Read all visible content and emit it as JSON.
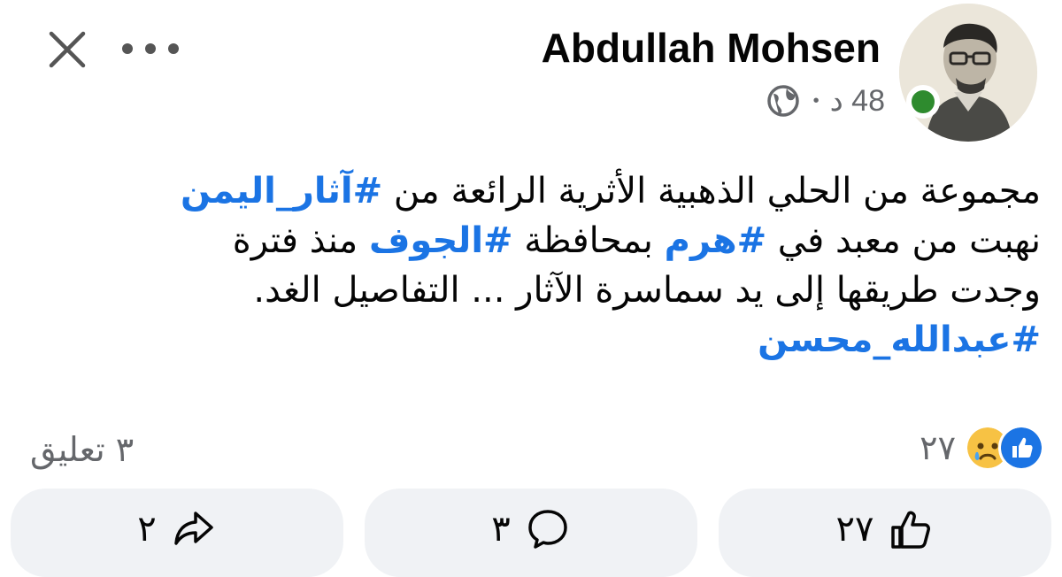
{
  "post": {
    "author_name": "Abdullah Mohsen",
    "time_ago": "48 د",
    "meta_separator": "•",
    "body_lines": [
      {
        "pre": "مجموعة من الحلي الذهبية الأثرية الرائعة من ",
        "tag": "#آثار_اليمن",
        "post": ""
      },
      {
        "pre": "نهبت من معبد في ",
        "tag": "#هرم",
        "mid": " بمحافظة ",
        "tag2": "#الجوف",
        "post": " منذ فترة"
      },
      {
        "pre": "وجدت طريقها إلى يد سماسرة الآثار ... التفاصيل الغد.",
        "tag": "",
        "post": ""
      },
      {
        "pre": "",
        "tag": "#عبدالله_محسن",
        "post": ""
      }
    ]
  },
  "engagement": {
    "reactions_count": "٢٧",
    "comments_label": "٣ تعليق"
  },
  "actions": {
    "like_count": "٢٧",
    "comment_count": "٣",
    "share_count": "٢"
  },
  "icons": {
    "close": "close-icon",
    "more": "more-dots-icon",
    "globe": "globe-icon",
    "like_reaction": "like-reaction-icon",
    "sad_reaction": "sad-reaction-icon",
    "like_action": "thumbs-up-icon",
    "comment_action": "comment-bubble-icon",
    "share_action": "share-arrow-icon"
  },
  "colors": {
    "hashtag": "#1b74e4",
    "online": "#2e8b2e",
    "button_bg": "#f0f2f5",
    "secondary_text": "#65676b"
  }
}
